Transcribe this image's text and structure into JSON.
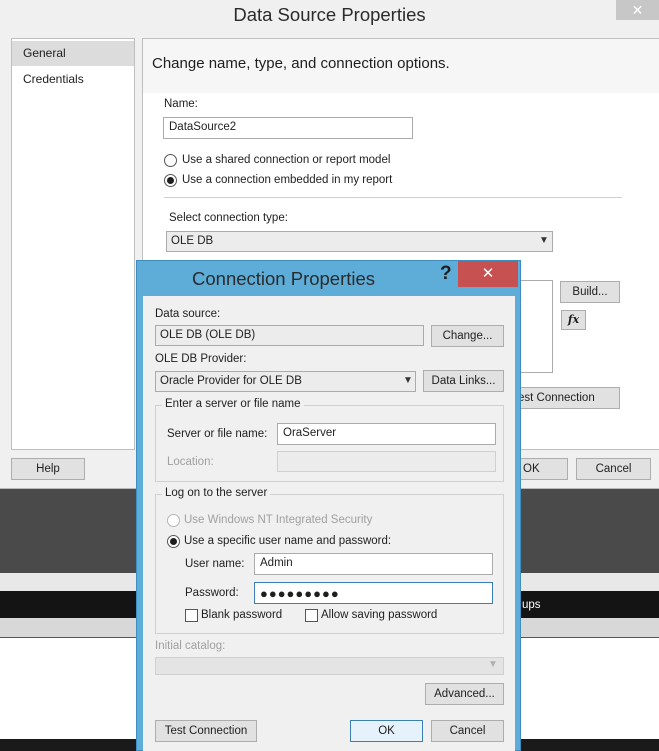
{
  "background": {
    "groups_fragment": "ups"
  },
  "data_source_dialog": {
    "title": "Data Source Properties",
    "nav": [
      "General",
      "Credentials"
    ],
    "heading": "Change name, type, and connection options.",
    "name_label": "Name:",
    "name_value": "DataSource2",
    "radio_shared": "Use a shared connection or report model",
    "radio_embedded": "Use a connection embedded in my report",
    "connection_type_label": "Select connection type:",
    "connection_type_value": "OLE DB",
    "build_button": "Build...",
    "fx_button": "fx",
    "test_connection_button": "est Connection",
    "help_button": "Help",
    "ok_button": "OK",
    "cancel_button": "Cancel"
  },
  "connection_dialog": {
    "title": "Connection Properties",
    "help_glyph": "?",
    "close_glyph": "✕",
    "data_source_label": "Data source:",
    "data_source_value": "OLE DB (OLE DB)",
    "change_button": "Change...",
    "provider_label": "OLE DB Provider:",
    "provider_value": "Oracle Provider for OLE DB",
    "data_links_button": "Data Links...",
    "server_group_label": "Enter a server or file name",
    "server_label": "Server or file name:",
    "server_value": "OraServer",
    "location_label": "Location:",
    "logon_group_label": "Log on to the server",
    "radio_nt": "Use Windows NT Integrated Security",
    "radio_specific": "Use a specific user name and password:",
    "user_label": "User name:",
    "user_value": "Admin",
    "password_label": "Password:",
    "password_value": "●●●●●●●●●",
    "blank_password_label": "Blank password",
    "allow_saving_label": "Allow saving password",
    "catalog_label": "Initial catalog:",
    "advanced_button": "Advanced...",
    "test_connection_button": "Test Connection",
    "ok_button": "OK",
    "cancel_button": "Cancel"
  }
}
